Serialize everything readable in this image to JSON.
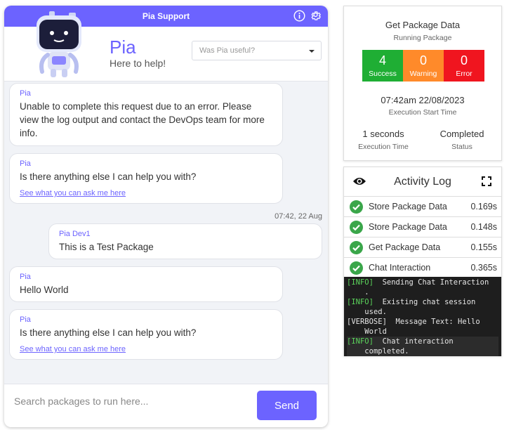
{
  "chat": {
    "title": "Pia Support",
    "bot_name": "Pia",
    "bot_subtitle": "Here to help!",
    "useful_select": {
      "placeholder": "Was Pia useful?"
    },
    "messages": [
      {
        "sender": "Pia",
        "text": "Unable to complete this request due to an error. Please view the log output and contact the DevOps team for more info."
      },
      {
        "sender": "Pia",
        "text": "Is there anything else I can help you with?",
        "link": "See what you can ask me here"
      },
      {
        "sender": "Pia Dev1",
        "text": "This is a Test Package",
        "timestamp": "07:42, 22 Aug"
      },
      {
        "sender": "Pia",
        "text": "Hello World"
      },
      {
        "sender": "Pia",
        "text": "Is there anything else I can help you with?",
        "link": "See what you can ask me here"
      }
    ],
    "input": {
      "placeholder": "Search packages to run here...",
      "value": ""
    },
    "send_label": "Send"
  },
  "package": {
    "title": "Get Package Data",
    "status_line": "Running Package",
    "stats": [
      {
        "value": "4",
        "label": "Success",
        "color": "#1fae34"
      },
      {
        "value": "0",
        "label": "Warning",
        "color": "#ff8a2a"
      },
      {
        "value": "0",
        "label": "Error",
        "color": "#f0151f"
      }
    ],
    "start_time": "07:42am 22/08/2023",
    "start_time_label": "Execution Start Time",
    "execution_time": "1 seconds",
    "execution_time_label": "Execution Time",
    "status": "Completed",
    "status_label": "Status"
  },
  "activity_log": {
    "title": "Activity Log",
    "items": [
      {
        "name": "Store Package Data",
        "duration": "0.169s"
      },
      {
        "name": "Store Package Data",
        "duration": "0.148s"
      },
      {
        "name": "Get Package Data",
        "duration": "0.155s"
      },
      {
        "name": "Chat Interaction",
        "duration": "0.365s"
      }
    ],
    "console": [
      {
        "level": "[INFO]",
        "text": "  Sending Chat Interaction\n    ."
      },
      {
        "level": "[INFO]",
        "text": "  Existing chat session\n    used."
      },
      {
        "level": "[VERBOSE]",
        "text": "  Message Text: Hello\n    World"
      },
      {
        "level": "[INFO]",
        "text": "  Chat interaction\n    completed."
      }
    ]
  },
  "icons": {
    "info": "info-icon",
    "settings": "gear-icon",
    "eye": "eye-icon",
    "expand": "expand-icon",
    "check": "check-circle-icon"
  },
  "colors": {
    "accent": "#6c63ff",
    "success": "#1fae34",
    "warning": "#ff8a2a",
    "error": "#f0151f"
  }
}
